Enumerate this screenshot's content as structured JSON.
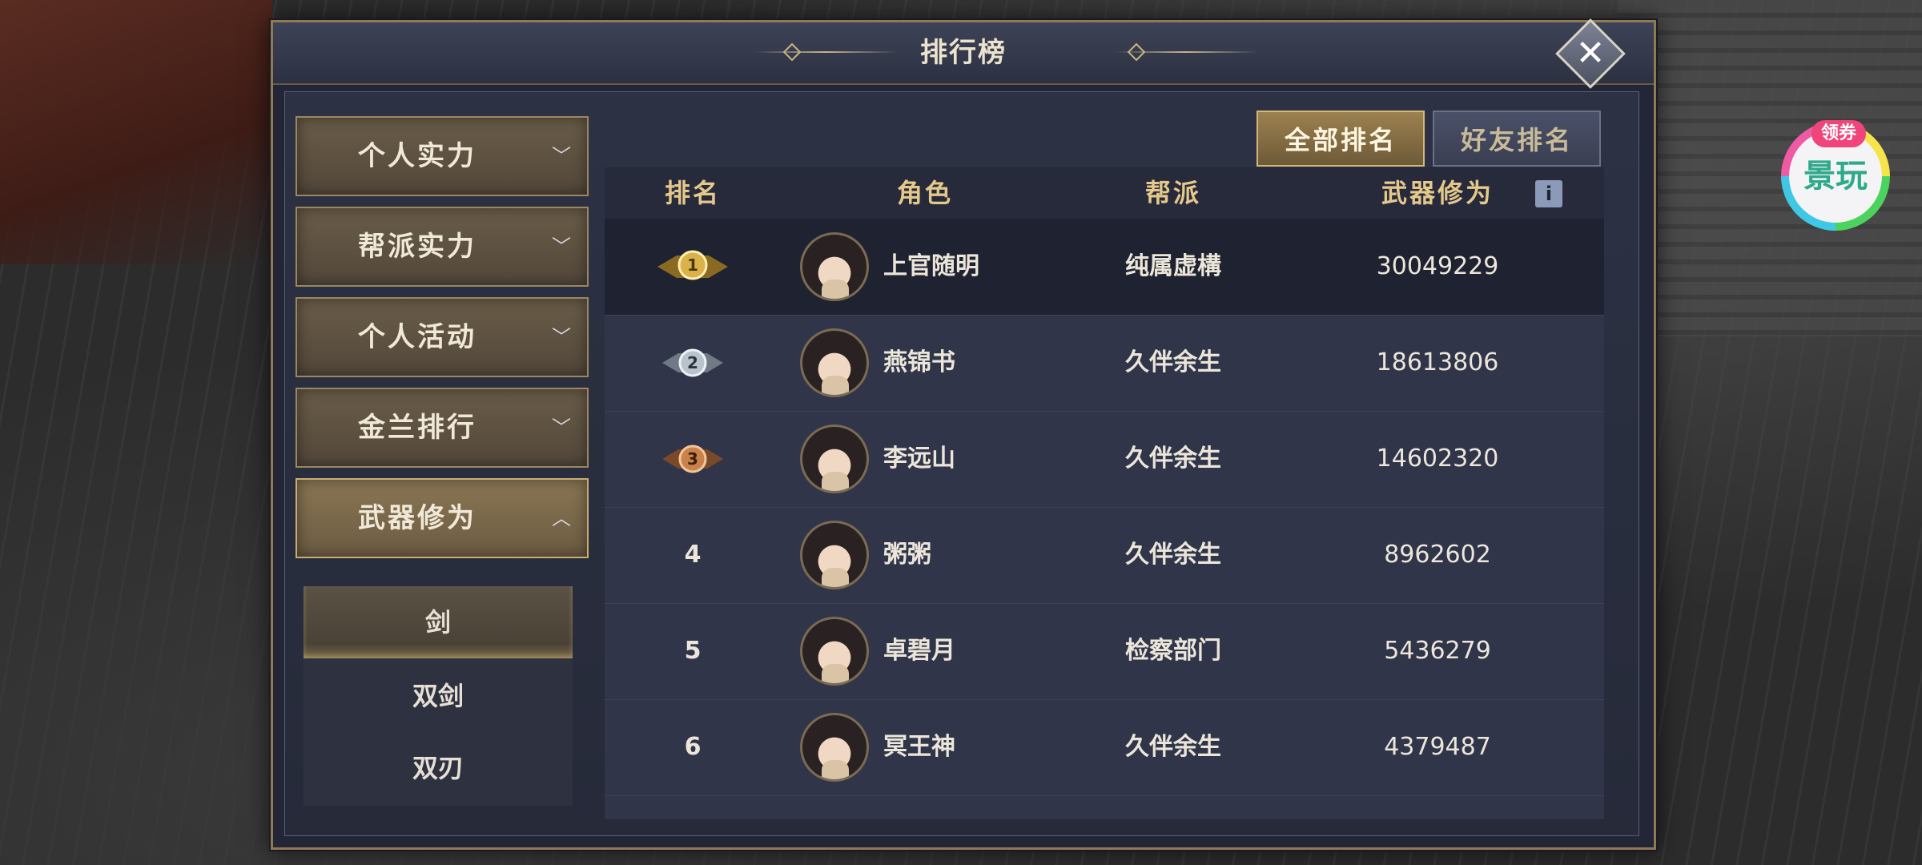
{
  "window": {
    "title": "排行榜",
    "close_glyph": "✕"
  },
  "sidebar": {
    "categories": [
      {
        "label": "个人实力",
        "chevron": "﹀"
      },
      {
        "label": "帮派实力",
        "chevron": "﹀"
      },
      {
        "label": "个人活动",
        "chevron": "﹀"
      },
      {
        "label": "金兰排行",
        "chevron": "﹀"
      },
      {
        "label": "武器修为",
        "chevron": "︿"
      }
    ],
    "subitems": [
      "剑",
      "双剑",
      "双刃"
    ]
  },
  "tabs": {
    "all": "全部排名",
    "friends": "好友排名"
  },
  "table": {
    "headers": {
      "rank": "排名",
      "role": "角色",
      "guild": "帮派",
      "score": "武器修为"
    },
    "info_icon_glyph": "i",
    "rows": [
      {
        "rank": "1",
        "name": "上官随明",
        "guild": "纯属虚構",
        "score": "30049229"
      },
      {
        "rank": "2",
        "name": "燕锦书",
        "guild": "久伴余生",
        "score": "18613806"
      },
      {
        "rank": "3",
        "name": "李远山",
        "guild": "久伴余生",
        "score": "14602320"
      },
      {
        "rank": "4",
        "name": "粥粥",
        "guild": "久伴余生",
        "score": "8962602"
      },
      {
        "rank": "5",
        "name": "卓碧月",
        "guild": "检察部门",
        "score": "5436279"
      },
      {
        "rank": "6",
        "name": "冥王神",
        "guild": "久伴余生",
        "score": "4379487"
      }
    ]
  },
  "float_badge": {
    "tag": "领券",
    "text": "景玩"
  },
  "colors": {
    "gold": "#e5c88b",
    "medal_gold": "#d9b24a",
    "medal_silver": "#b9c3cc",
    "medal_bronze": "#c9824c",
    "panel_bg": "#232636"
  }
}
